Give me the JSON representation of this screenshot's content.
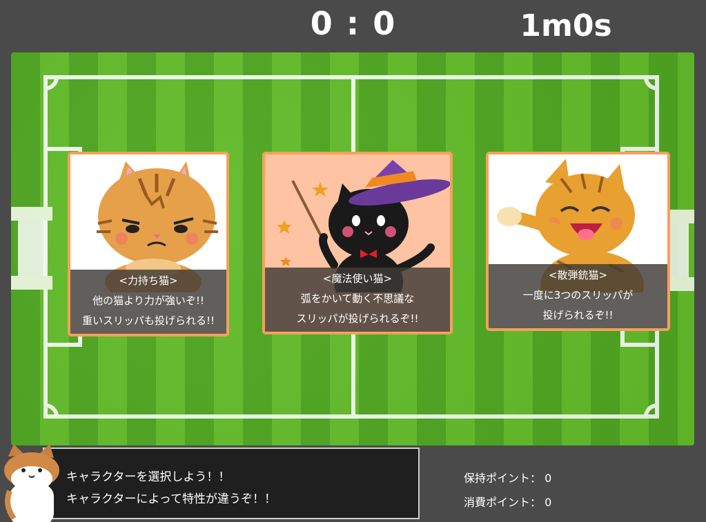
{
  "hud": {
    "score": "0 : 0",
    "timer": "1m0s"
  },
  "cards": [
    {
      "name": "<力持ち猫>",
      "line1": "他の猫より力が強いぞ!!",
      "line2": "重いスリッパも投げられる!!",
      "icon": "strong-tabby-cat"
    },
    {
      "name": "<魔法使い猫>",
      "line1": "弧をかいて動く不思議な",
      "line2": "スリッパが投げられるぞ!!",
      "icon": "wizard-black-cat"
    },
    {
      "name": "<散弾銃猫>",
      "line1": "一度に3つのスリッパが",
      "line2": "投げられるぞ!!",
      "icon": "laughing-orange-cat"
    }
  ],
  "message": {
    "line1": "キャラクターを選択しよう！！",
    "line2": "キャラクターによって特性が違うぞ！！"
  },
  "points": {
    "held_label": "保持ポイント：",
    "held_value": "0",
    "spent_label": "消費ポイント：",
    "spent_value": "0"
  },
  "colors": {
    "card_border": "#f5a05a",
    "field_green": "#4ea520",
    "background": "#4a4a4a"
  }
}
